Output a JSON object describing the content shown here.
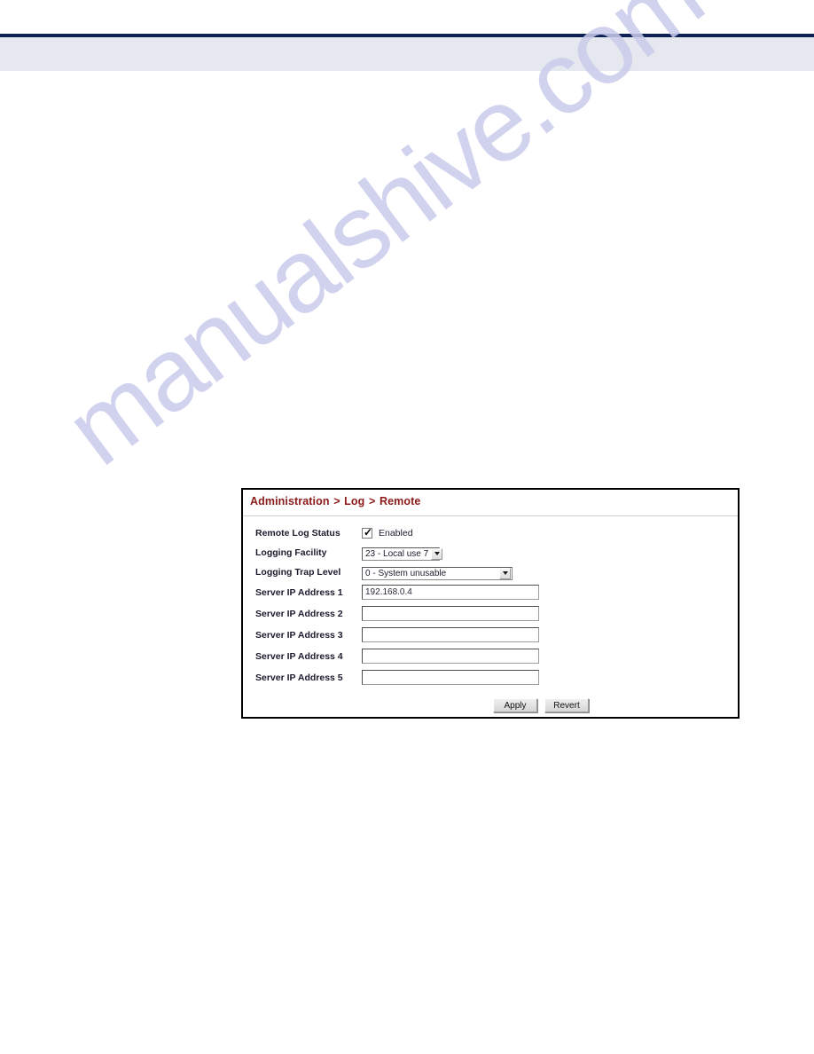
{
  "page": {
    "watermark_text": "manualshive.com",
    "accent_rule_color": "#0d2155",
    "header_band_color": "#e5e8ef"
  },
  "panel": {
    "breadcrumb": {
      "items": [
        "Administration",
        "Log",
        "Remote"
      ],
      "separator": ">",
      "full_text": "Administration > Log > Remote",
      "color": "#8c1a1a"
    },
    "form": {
      "rows": [
        {
          "label": "Remote Log Status",
          "type": "checkbox",
          "checked": true,
          "checkbox_label": "Enabled"
        },
        {
          "label": "Logging Facility",
          "type": "select",
          "value": "23 - Local use 7"
        },
        {
          "label": "Logging Trap Level",
          "type": "select",
          "value": "0 - System unusable"
        },
        {
          "label": "Server IP Address 1",
          "type": "text",
          "value": "192.168.0.4"
        },
        {
          "label": "Server IP Address 2",
          "type": "text",
          "value": ""
        },
        {
          "label": "Server IP Address 3",
          "type": "text",
          "value": ""
        },
        {
          "label": "Server IP Address 4",
          "type": "text",
          "value": ""
        },
        {
          "label": "Server IP Address 5",
          "type": "text",
          "value": ""
        }
      ]
    },
    "buttons": {
      "apply_label": "Apply",
      "revert_label": "Revert"
    }
  }
}
